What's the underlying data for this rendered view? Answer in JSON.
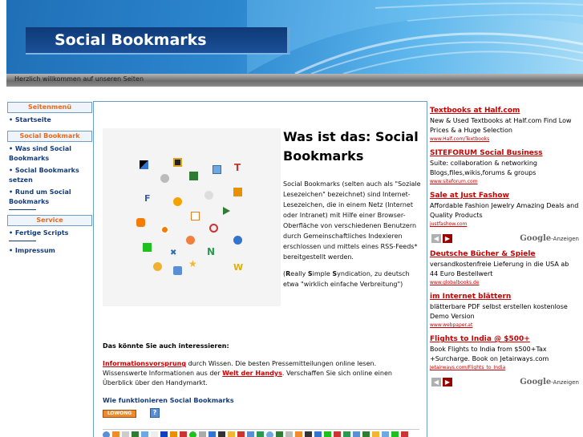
{
  "header": {
    "title": "Social Bookmarks",
    "welcome": "Herzlich willkommen auf unseren Seiten"
  },
  "sidebar": {
    "sections": [
      {
        "heading": "Seitenmenü",
        "items": [
          "Startseite"
        ]
      },
      {
        "heading": "Social Bookmark",
        "items": [
          "Was sind Social Bookmarks",
          "Social Bookmarks setzen",
          "Rund um Social Bookmarks"
        ]
      },
      {
        "heading": "Service",
        "items": [
          "Fertige Scripts",
          "Impressum"
        ]
      }
    ]
  },
  "main": {
    "heading": "Was ist das: Social Bookmarks",
    "intro": "Social Bookmarks (selten auch als \"Soziale Lesezeichen\" bezeichnet) sind Internet-Lesezeichen, die in einem Netz (Internet oder Intranet) mit Hilfe einer Browser-Oberfläche von verschiedenen Benutzern durch Gemeinschaftliches Indexieren erschlossen und mittels eines RSS-Feeds* bereitgestellt werden.",
    "rss_note": {
      "open": "(",
      "r": "R",
      "rest1": "eally ",
      "s1": "S",
      "rest2": "imple ",
      "s2": "S",
      "rest3": "yndication, zu deutsch etwa \"wirklich einfache Verbreitung\")"
    },
    "interest_heading": "Das könnte Sie auch interessieren:",
    "interest": {
      "link1": "Informationsvorsprung",
      "text1": " durch Wissen. Die besten Pressemitteilungen online lesen. Wissenswerte Informationen aus der ",
      "link2": "Welt der Handys",
      "text2": ". Verschaffen Sie sich online einen Überblick über den Handymarkt."
    },
    "how_heading": "Wie funktionieren Social Bookmarks",
    "rating_badge": "LOWONG",
    "help_icon": "?"
  },
  "ads": {
    "group1": [
      {
        "title": "Textbooks at Half.com",
        "text": "New & Used Textbooks at Half.com Find Low Prices & a Huge Selection",
        "url": "www.Half.com/Textbooks"
      },
      {
        "title": "SITEFORUM Social Business",
        "text": "Suite: collaboration & networking Blogs,files,wikis,forums & groups",
        "url": "www.siteforum.com"
      },
      {
        "title": "Sale at Just Fashow",
        "text": "Affordable Fashion Jewelry Amazing Deals and Quality Products",
        "url": "justfashow.com"
      }
    ],
    "group2": [
      {
        "title": "Deutsche Bücher & Spiele",
        "text": "versandkostenfreie Lieferung in die USA ab 44 Euro Bestellwert",
        "url": "www.globalbooks.de"
      },
      {
        "title": "im Internet blättern",
        "text": "blätterbare PDF selbst erstellen kostenlose Demo Version",
        "url": "www.webpaper.at"
      },
      {
        "title": "Flights to India @ $500+",
        "text": "Book Flights to India from $500+Tax +Surcharge. Book on Jetairways.com",
        "url": "Jetairways.com/Flights_to_India"
      }
    ],
    "nav_prev": "◀",
    "nav_next": "▶",
    "google_word": "Google",
    "google_suffix": "-Anzeigen"
  },
  "colors": {
    "ad_title": "#cc0000",
    "menu_heading": "#e8691c",
    "menu_link": "#143c7a",
    "nav_prev_bg": "#b0b0b0",
    "nav_next_bg": "#990000"
  }
}
